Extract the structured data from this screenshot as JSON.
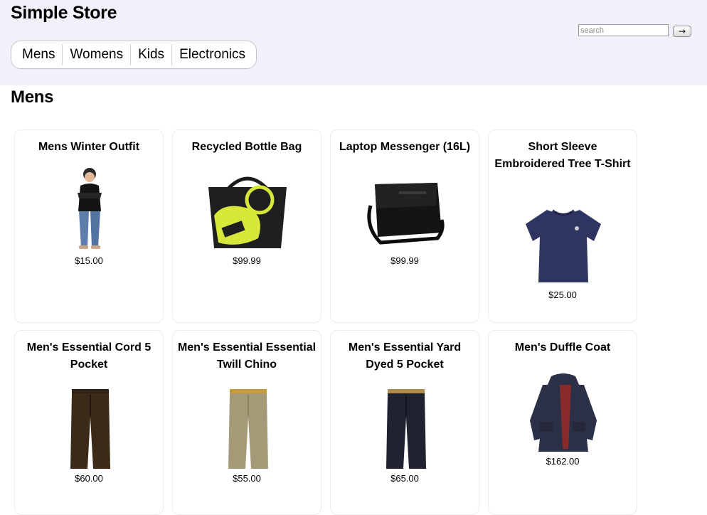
{
  "header": {
    "title": "Simple Store",
    "search": {
      "placeholder": "search",
      "value": "",
      "button_label": "→"
    }
  },
  "nav": {
    "items": [
      {
        "label": "Mens"
      },
      {
        "label": "Womens"
      },
      {
        "label": "Kids"
      },
      {
        "label": "Electronics"
      }
    ]
  },
  "section": {
    "title": "Mens"
  },
  "products": [
    {
      "title": "Mens Winter Outfit",
      "price": "$15.00",
      "image": "person-outfit-photo"
    },
    {
      "title": "Recycled Bottle Bag",
      "price": "$99.99",
      "image": "tote-bag-photo"
    },
    {
      "title": "Laptop Messenger (16L)",
      "price": "$99.99",
      "image": "messenger-bag-photo"
    },
    {
      "title": "Short Sleeve Embroidered Tree T-Shirt",
      "price": "$25.00",
      "image": "tshirt-photo"
    },
    {
      "title": "Men's Essential Cord 5 Pocket",
      "price": "$60.00",
      "image": "brown-pants-photo"
    },
    {
      "title": "Men's Essential Essential Twill Chino",
      "price": "$55.00",
      "image": "khaki-pants-photo"
    },
    {
      "title": "Men's Essential Yard Dyed 5 Pocket",
      "price": "$65.00",
      "image": "dark-jeans-photo"
    },
    {
      "title": "Men's Duffle Coat",
      "price": "$162.00",
      "image": "duffle-coat-photo"
    }
  ],
  "colors": {
    "header_bg": "#f1f1fb",
    "card_border": "#ececec",
    "tshirt": "#2e3560",
    "bag_accent": "#d7e83a"
  }
}
